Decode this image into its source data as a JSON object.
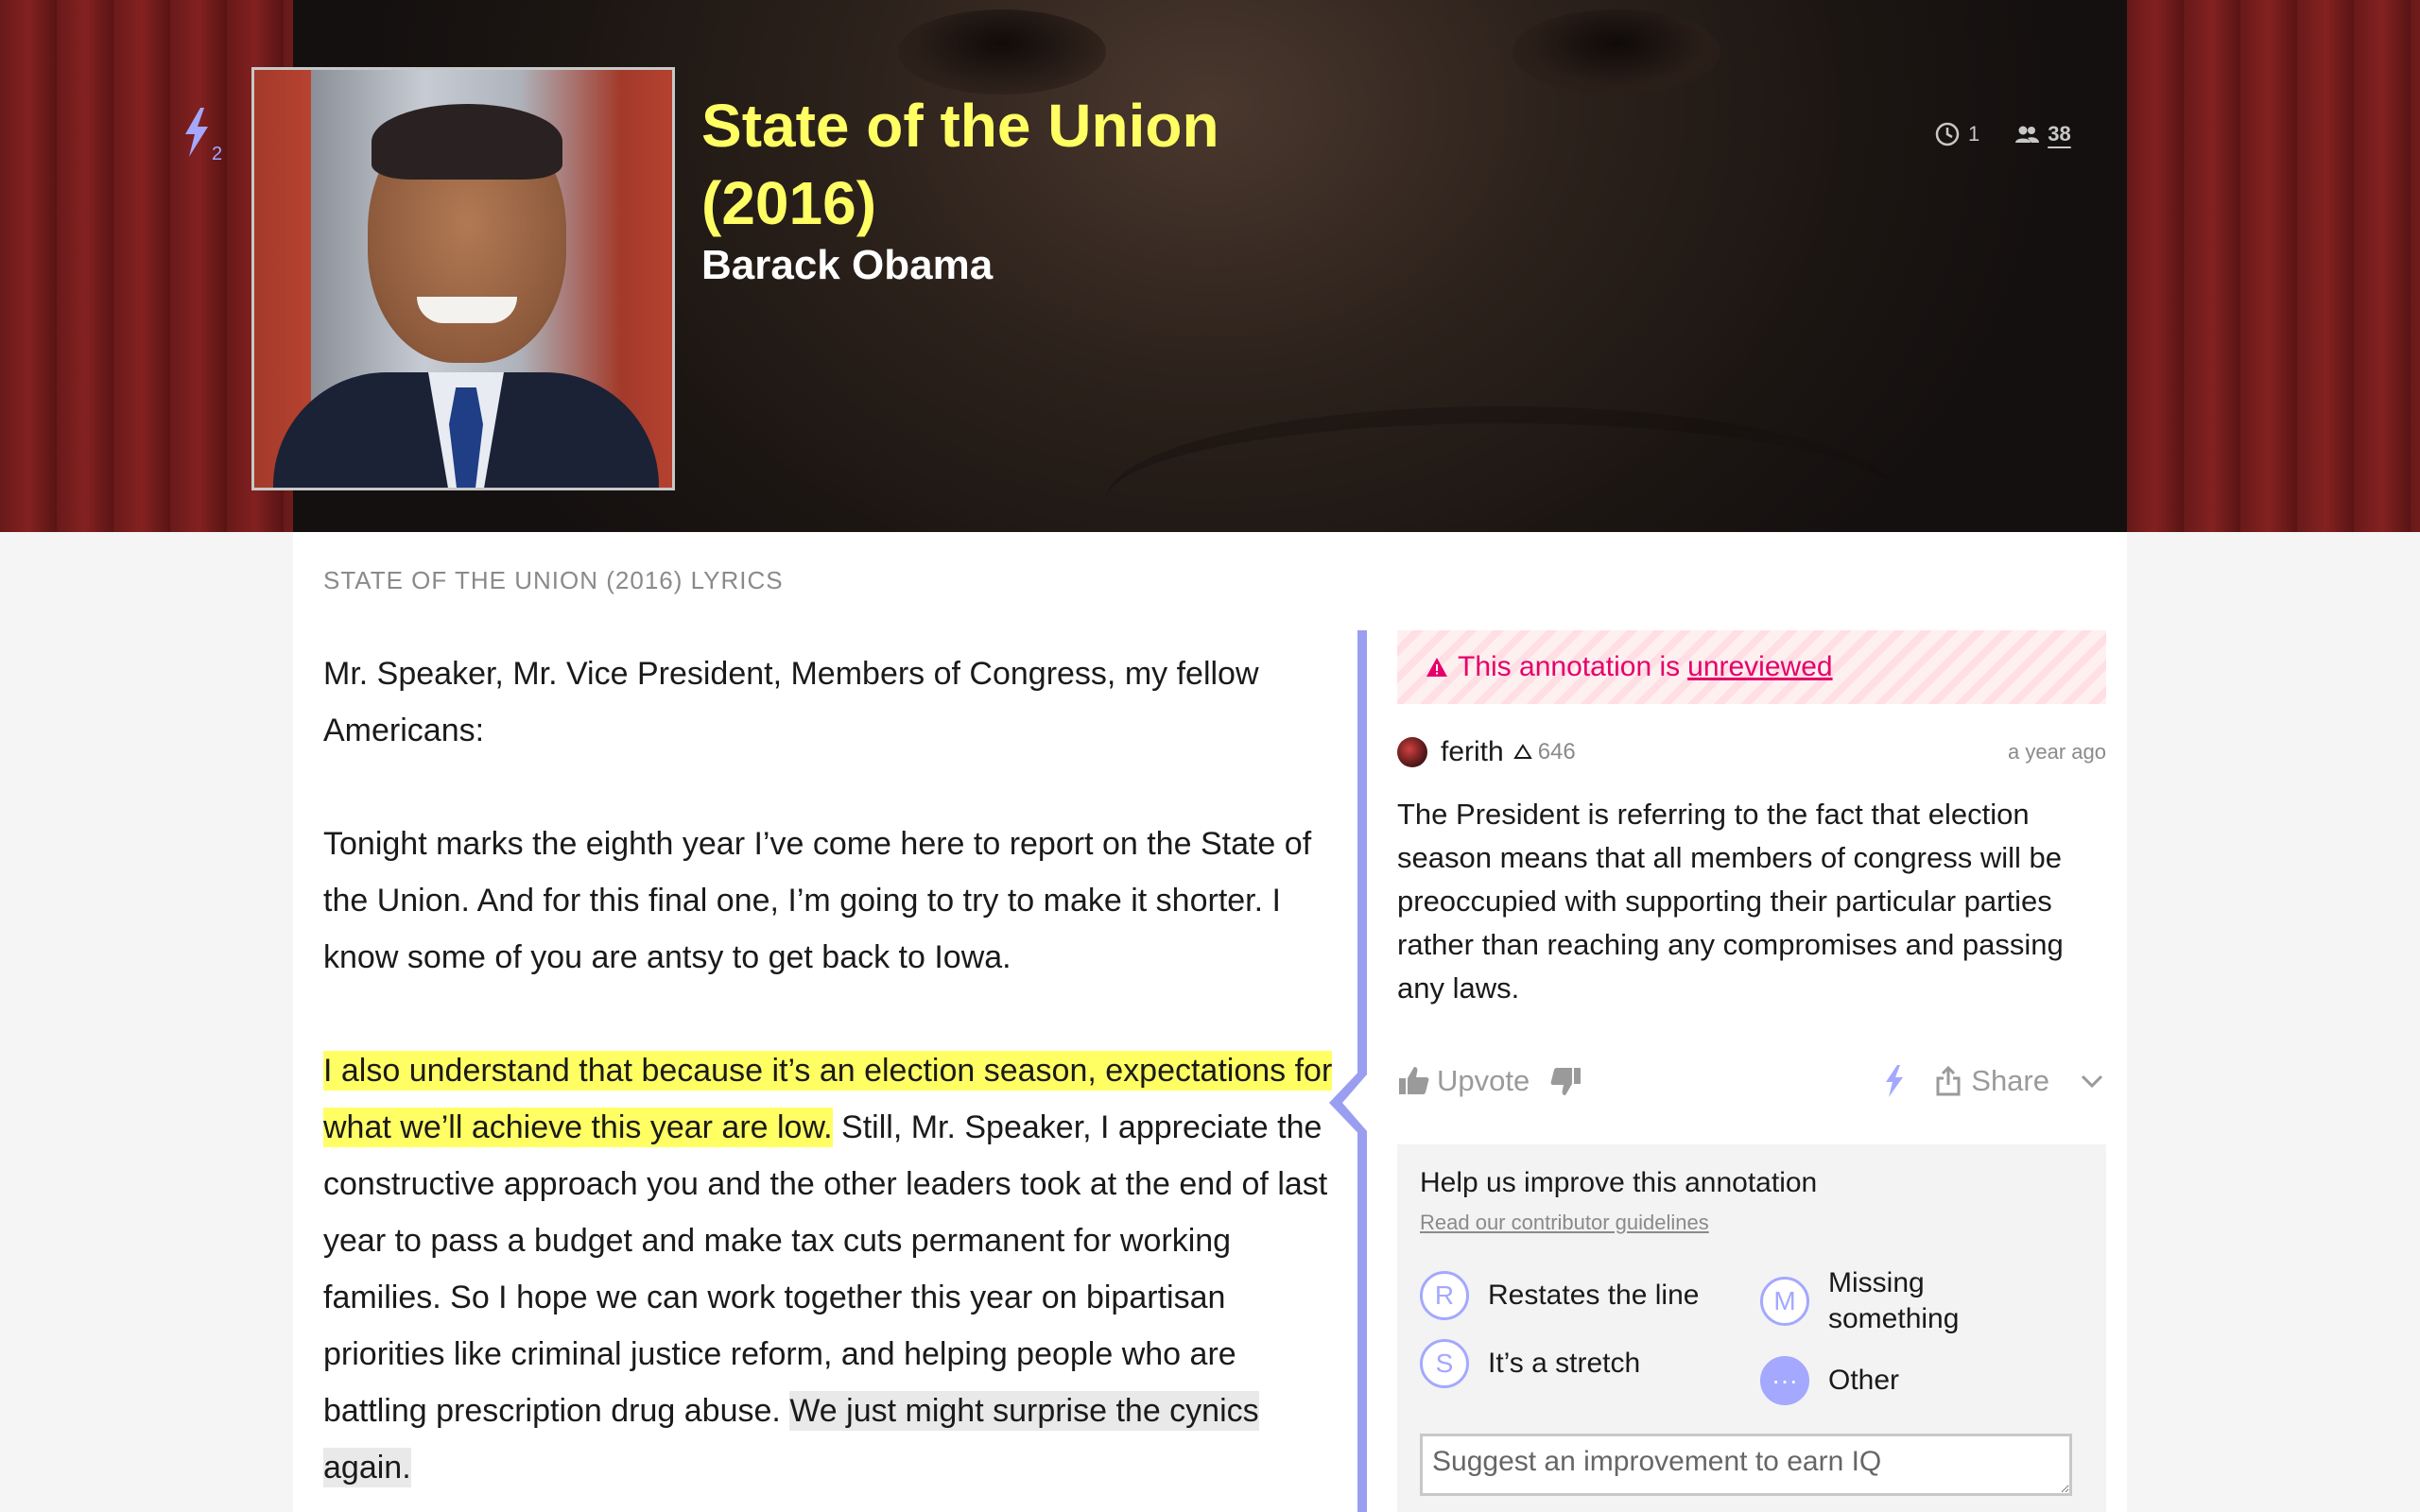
{
  "header": {
    "title": "State of the Union (2016)",
    "artist": "Barack Obama",
    "iq_subscript": "2",
    "stat_history_count": "1",
    "stat_contributors_count": "38"
  },
  "lyrics": {
    "label": "STATE OF THE UNION (2016) LYRICS",
    "p1": "Mr. Speaker, Mr. Vice President, Members of Congress, my fellow Americans:",
    "p2": "Tonight marks the eighth year I’ve come here to report on the State of the Union. And for this final one, I’m going to try to make it shorter. I know some of you are antsy to get back to Iowa.",
    "p3_highlight": "I also understand that because it’s an election season, expectations for what we’ll achieve this year are low.",
    "p3_rest": " Still, Mr. Speaker, I appreciate the constructive approach you and the other leaders took at the end of last year to pass a budget and make tax cuts permanent for working families. So I hope we can work together this year on bipartisan priorities like criminal justice reform, and helping people who are battling prescription drug abuse. ",
    "p3_grey": "We just might surprise the cynics again."
  },
  "annotation": {
    "unreviewed_prefix": "This annotation is",
    "unreviewed_link": "unreviewed",
    "author": "ferith",
    "author_iq": "646",
    "timestamp": "a year ago",
    "body": "The President is referring to the fact that election season means that all members of congress will be preoccupied with supporting their particular parties rather than reaching any compromises and passing any laws.",
    "upvote_label": "Upvote",
    "share_label": "Share"
  },
  "improve": {
    "title": "Help us improve this annotation",
    "guidelines_link": "Read our contributor guidelines",
    "options": [
      {
        "letter": "R",
        "label": "Restates the line"
      },
      {
        "letter": "S",
        "label": "It’s a stretch"
      },
      {
        "letter": "M",
        "label": "Missing something"
      },
      {
        "letter": "···",
        "label": "Other"
      }
    ],
    "input_placeholder": "Suggest an improvement to earn IQ"
  },
  "colors": {
    "title_yellow": "#ffff64",
    "highlight_yellow": "#ffff64",
    "accent_purple": "#9a9ef0",
    "unreviewed_pink": "#e5006a"
  }
}
